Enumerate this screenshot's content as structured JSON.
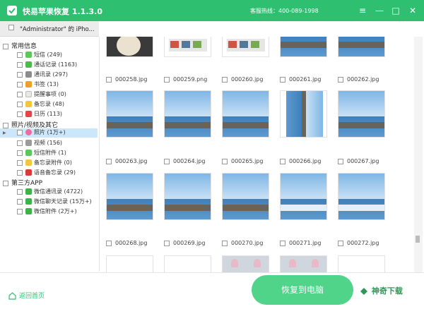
{
  "app": {
    "title": "快易苹果恢复 1.1.3.0",
    "hotline": "客服热线：400-089-1998"
  },
  "device": {
    "label": "\"Administrator\" 的 iPho..."
  },
  "sidebar": {
    "groups": [
      {
        "label": "常用信息",
        "items": [
          {
            "label": "短信 (249)",
            "color": "#5cc85c"
          },
          {
            "label": "通话记录 (1163)",
            "color": "#4cbb4c"
          },
          {
            "label": "通讯录 (297)",
            "color": "#8c8c8c"
          },
          {
            "label": "书签 (13)",
            "color": "#f0a020"
          },
          {
            "label": "提醒事项 (0)",
            "color": "#e8e8e8"
          },
          {
            "label": "备忘录 (48)",
            "color": "#f3c737"
          },
          {
            "label": "日历 (113)",
            "color": "#e04848"
          }
        ]
      },
      {
        "label": "照片/视频及其它",
        "items": [
          {
            "label": "照片 (1万+)",
            "color": "#f06aa0"
          },
          {
            "label": "视频 (156)",
            "color": "#9b9b9b"
          },
          {
            "label": "短信附件 (1)",
            "color": "#5cc85c"
          },
          {
            "label": "备忘录附件 (0)",
            "color": "#f3c737"
          },
          {
            "label": "语音备忘录 (29)",
            "color": "#d83a3a"
          }
        ]
      },
      {
        "label": "第三方APP",
        "items": [
          {
            "label": "微信通讯录 (4722)",
            "color": "#3bb24a"
          },
          {
            "label": "微信聊天记录 (15万+)",
            "color": "#3bb24a"
          },
          {
            "label": "微信附件 (2万+)",
            "color": "#3bb24a"
          }
        ]
      }
    ]
  },
  "photos": {
    "row1": [
      "000258.jpg",
      "000259.png",
      "000260.jpg",
      "000261.jpg",
      "000262.jpg"
    ],
    "row2": [
      "000263.jpg",
      "000264.jpg",
      "000265.jpg",
      "000266.jpg",
      "000267.jpg"
    ],
    "row3": [
      "000268.jpg",
      "000269.jpg",
      "000270.jpg",
      "000271.jpg",
      "000272.jpg"
    ]
  },
  "footer": {
    "home_label": "返回首页",
    "recover_label": "恢复到电脑",
    "watermark": "神奇下载"
  },
  "colors": {
    "accent": "#2fbf71",
    "selected_row": "#cce6fa"
  }
}
